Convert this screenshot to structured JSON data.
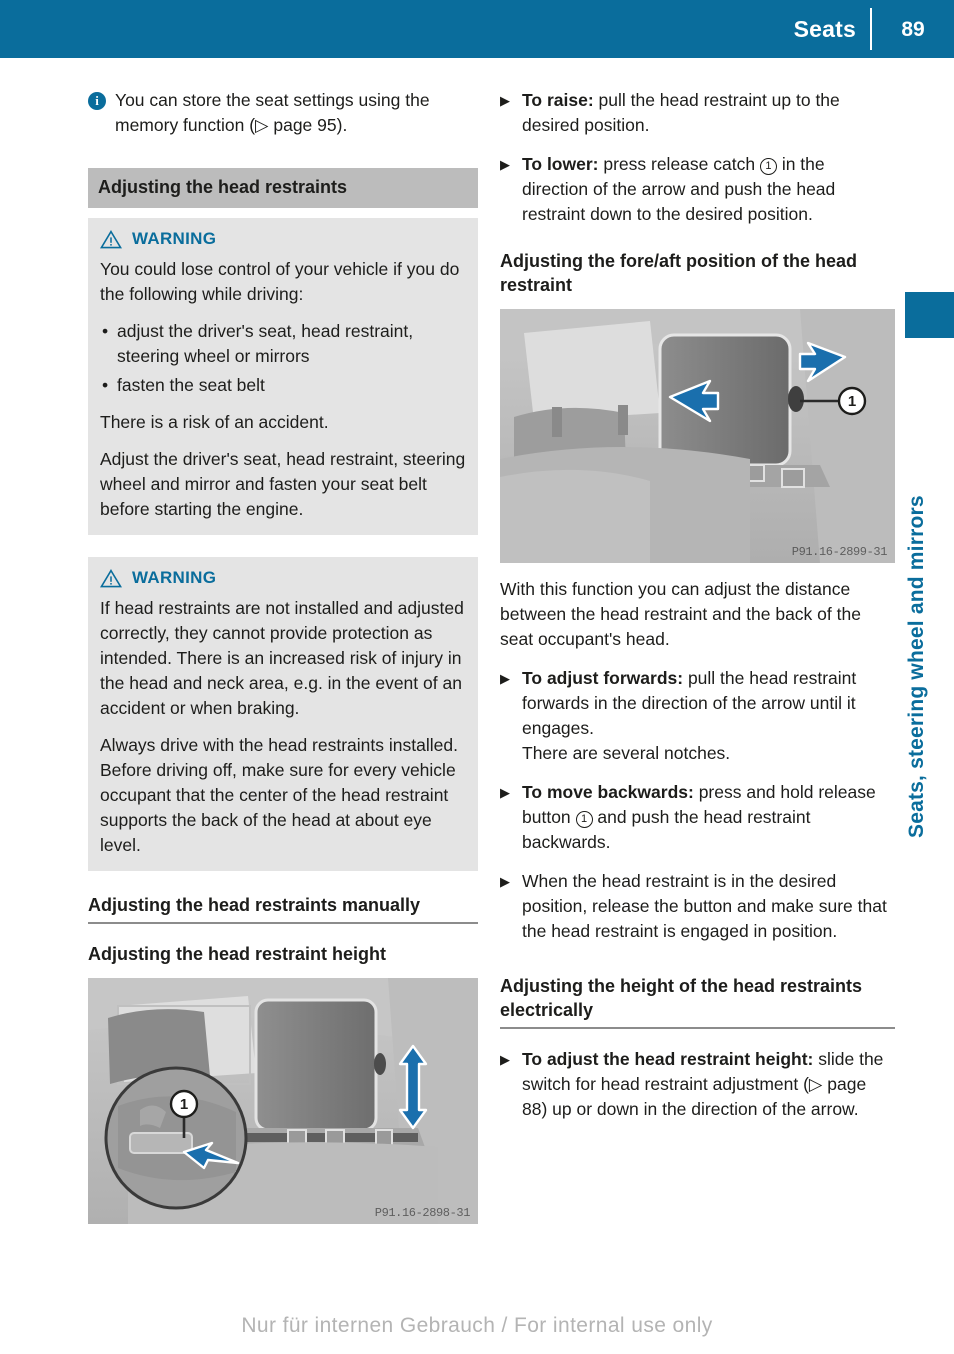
{
  "header": {
    "title": "Seats",
    "page_number": "89"
  },
  "side_tab": {
    "label": "Seats, steering wheel and mirrors"
  },
  "colors": {
    "accent_blue": "#0a6d9c",
    "section_bar_gray": "#bcbcbc",
    "warning_box_gray": "#e4e4e4"
  },
  "left_column": {
    "note": {
      "icon": "info-icon",
      "text": "You can store the seat settings using the memory function (▷ page 95)."
    },
    "section_heading": "Adjusting the head restraints",
    "warning_1": {
      "icon": "warning-triangle-icon",
      "label": "WARNING",
      "intro": "You could lose control of your vehicle if you do the following while driving:",
      "bullets": [
        "adjust the driver's seat, head restraint, steering wheel or mirrors",
        "fasten the seat belt"
      ],
      "risk": "There is a risk of an accident.",
      "action": "Adjust the driver's seat, head restraint, steering wheel and mirror and fasten your seat belt before starting the engine."
    },
    "warning_2": {
      "icon": "warning-triangle-icon",
      "label": "WARNING",
      "paragraph_1": "If head restraints are not installed and adjusted correctly, they cannot provide protection as intended. There is an increased risk of injury in the head and neck area, e.g. in the event of an accident or when braking.",
      "paragraph_2": "Always drive with the head restraints installed. Before driving off, make sure for every vehicle occupant that the center of the head restraint supports the back of the head at about eye level."
    },
    "heading_manual": "Adjusting the head restraints manually",
    "heading_height": "Adjusting the head restraint height",
    "figure": {
      "code": "P91.16-2898-31",
      "callout": "1",
      "description": "head-restraint-height-photo"
    }
  },
  "right_column": {
    "steps_height": [
      {
        "marker": "▶",
        "bold": "To raise:",
        "text": " pull the head restraint up to the desired position."
      },
      {
        "marker": "▶",
        "bold": "To lower:",
        "text_before": " press release catch ",
        "callout": "1",
        "text_after": " in the direction of the arrow and push the head restraint down to the desired position."
      }
    ],
    "heading_foreaft": "Adjusting the fore/aft position of the head restraint",
    "figure": {
      "code": "P91.16-2899-31",
      "callout": "1",
      "description": "head-restraint-fore-aft-photo"
    },
    "intro_foreaft": "With this function you can adjust the distance between the head restraint and the back of the seat occupant's head.",
    "steps_foreaft": [
      {
        "marker": "▶",
        "bold": "To adjust forwards:",
        "text": " pull the head restraint forwards in the direction of the arrow until it engages.",
        "sub": "There are several notches."
      },
      {
        "marker": "▶",
        "bold": "To move backwards:",
        "text_before": " press and hold release button ",
        "callout": "1",
        "text_after": " and push the head restraint backwards."
      },
      {
        "marker": "▶",
        "bold": "",
        "text": "When the head restraint is in the desired position, release the button and make sure that the head restraint is engaged in position."
      }
    ],
    "heading_electric": "Adjusting the height of the head restraints electrically",
    "steps_electric": [
      {
        "marker": "▶",
        "bold": "To adjust the head restraint height:",
        "text": " slide the switch for head restraint adjustment (▷ page 88) up or down in the direction of the arrow."
      }
    ]
  },
  "footer": {
    "watermark": "Nur für internen Gebrauch / For internal use only"
  }
}
